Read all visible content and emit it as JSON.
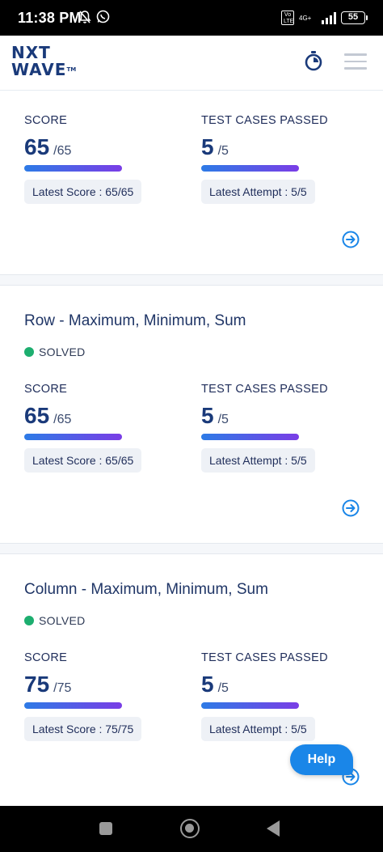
{
  "status_bar": {
    "time": "11:38 PM",
    "network_lte": "Vo LTE",
    "network_type": "4G+",
    "battery": "55"
  },
  "header": {
    "logo_line1": "NXT",
    "logo_line2": "WAVE",
    "logo_tm": "TM",
    "timer_icon": "stopwatch-icon",
    "menu_icon": "hamburger-menu-icon"
  },
  "cards": [
    {
      "title": "",
      "status": "",
      "score_label": "SCORE",
      "score_value": "65",
      "score_max": "/65",
      "latest_score": "Latest Score : 65/65",
      "tests_label": "TEST CASES PASSED",
      "tests_value": "5",
      "tests_max": "/5",
      "latest_attempt": "Latest Attempt : 5/5"
    },
    {
      "title": "Row - Maximum, Minimum, Sum",
      "status": "SOLVED",
      "score_label": "SCORE",
      "score_value": "65",
      "score_max": "/65",
      "latest_score": "Latest Score : 65/65",
      "tests_label": "TEST CASES PASSED",
      "tests_value": "5",
      "tests_max": "/5",
      "latest_attempt": "Latest Attempt : 5/5"
    },
    {
      "title": "Column - Maximum, Minimum, Sum",
      "status": "SOLVED",
      "score_label": "SCORE",
      "score_value": "75",
      "score_max": "/75",
      "latest_score": "Latest Score : 75/75",
      "tests_label": "TEST CASES PASSED",
      "tests_value": "5",
      "tests_max": "/5",
      "latest_attempt": "Latest Attempt : 5/5"
    }
  ],
  "help_button": "Help",
  "colors": {
    "brand": "#1a3a7a",
    "solved": "#1dae6f",
    "help": "#1a86e8",
    "bar_start": "#2d7be6",
    "bar_end": "#7a3de6"
  }
}
